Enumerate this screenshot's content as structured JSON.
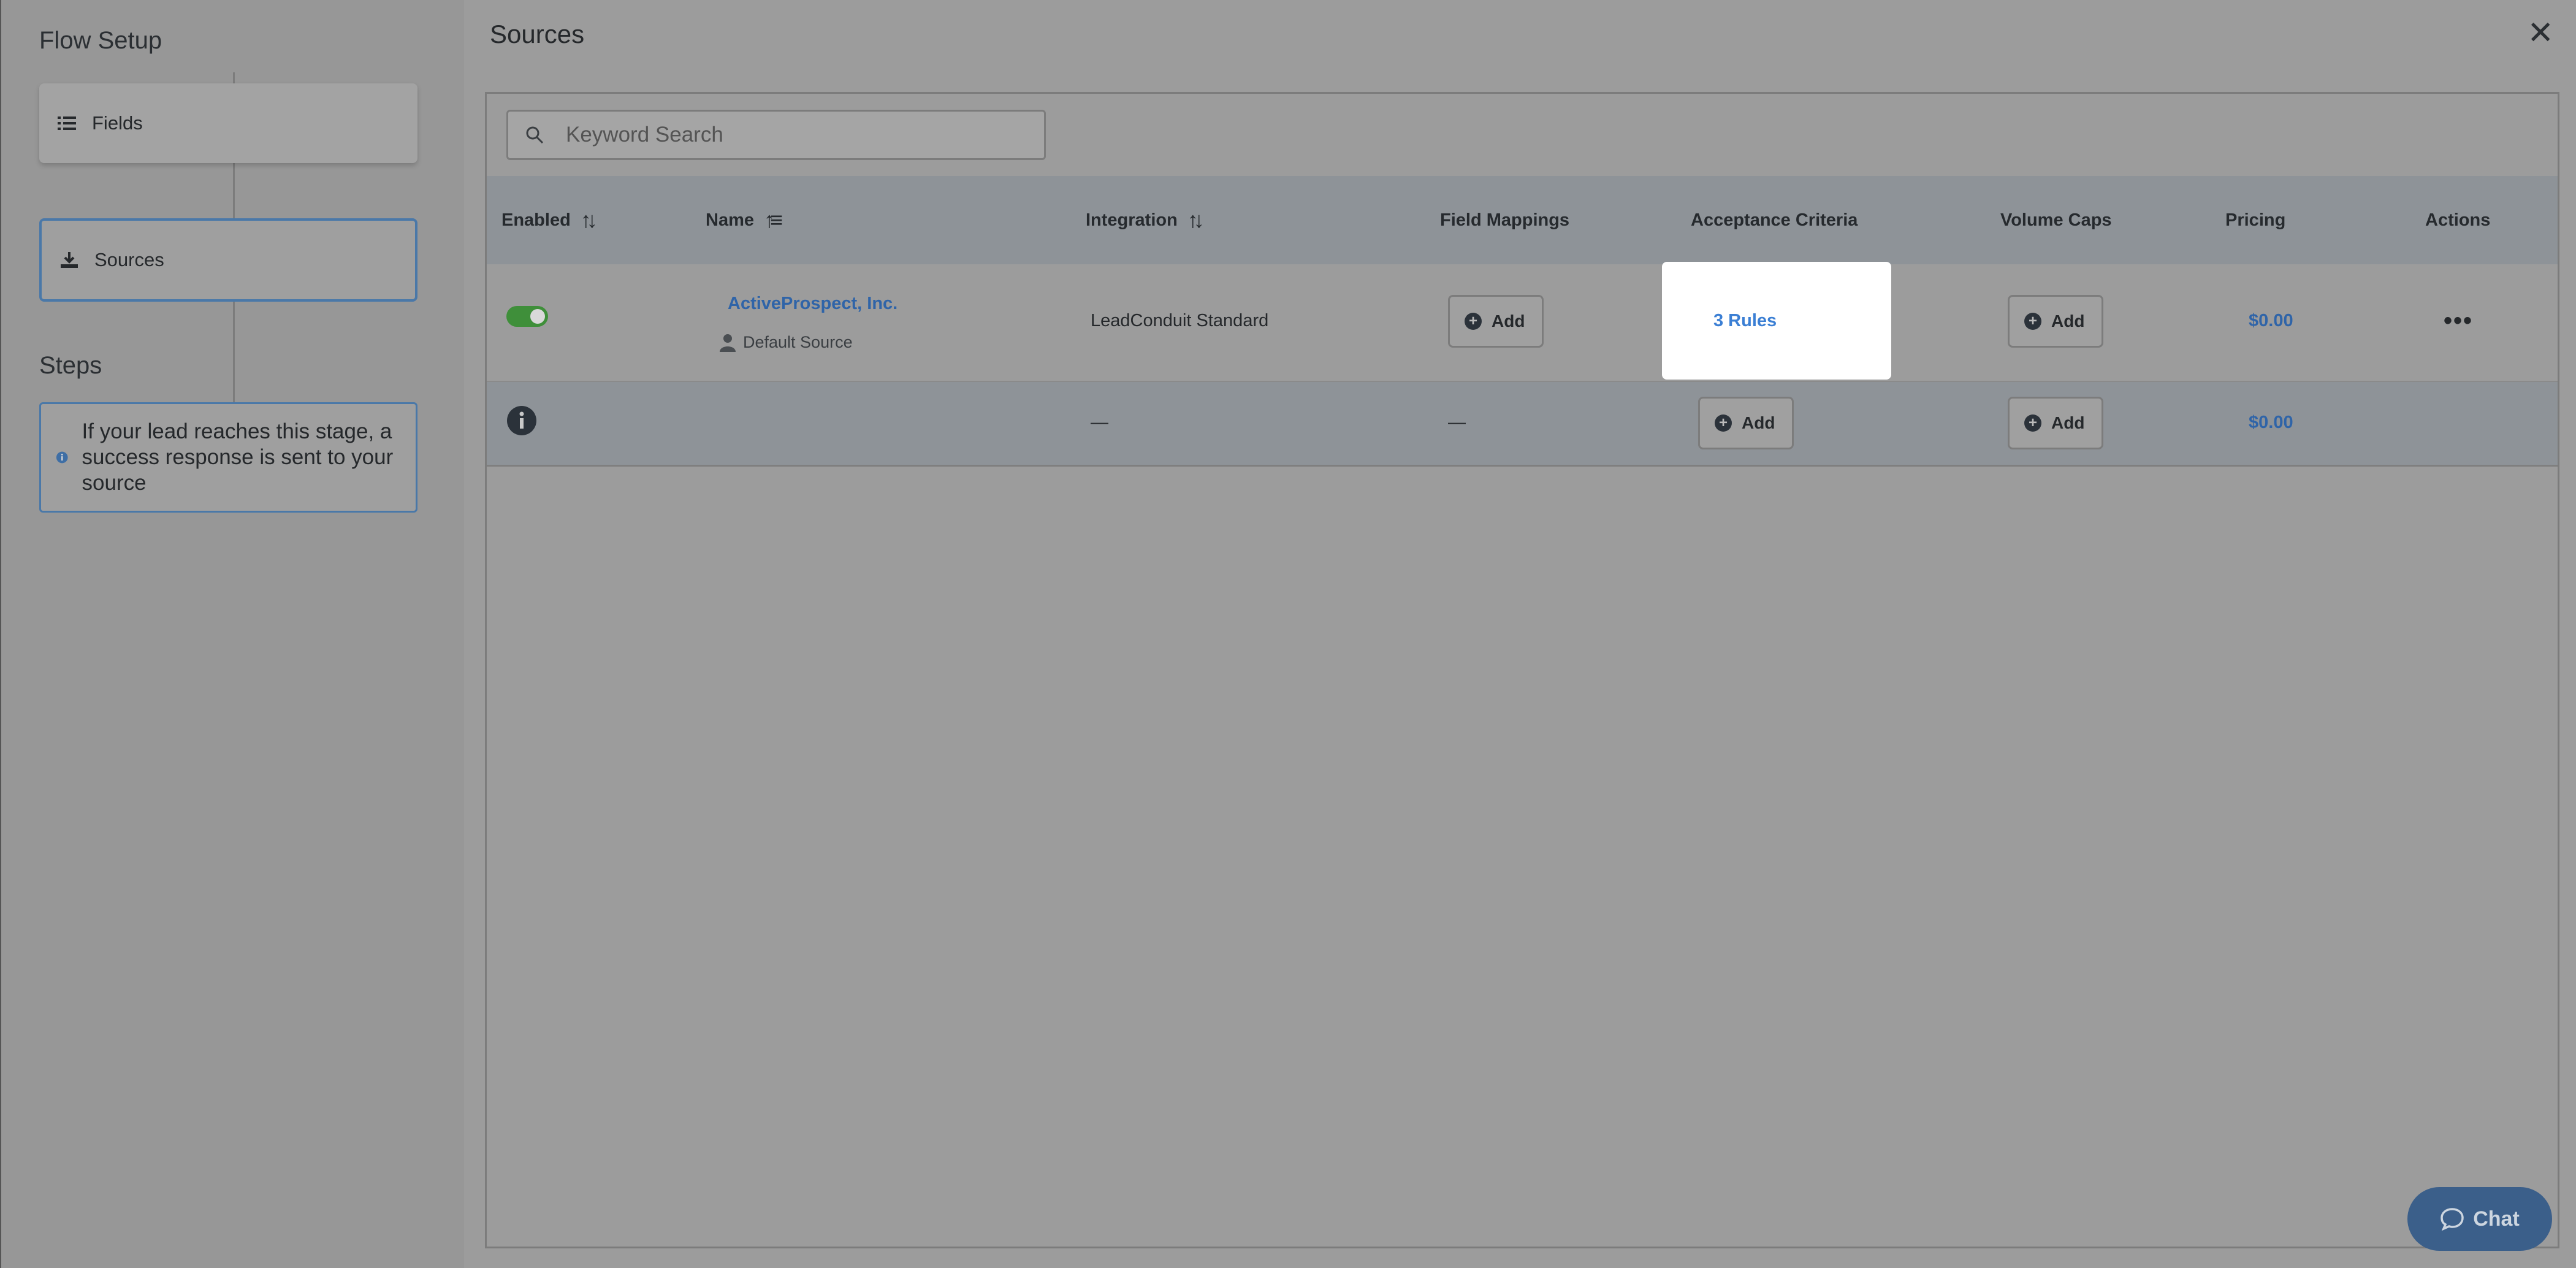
{
  "sidebar": {
    "title": "Flow Setup",
    "items": [
      {
        "label": "Fields",
        "icon": "list-icon"
      },
      {
        "label": "Sources",
        "icon": "download-icon"
      }
    ],
    "steps_title": "Steps",
    "info": {
      "text": "If your lead reaches this stage, a success response is sent to your source",
      "icon": "info-icon"
    }
  },
  "main": {
    "title": "Sources",
    "close_label": "✕",
    "search": {
      "placeholder": "Keyword Search"
    },
    "columns": [
      "Enabled",
      "Name",
      "Integration",
      "Field Mappings",
      "Acceptance Criteria",
      "Volume Caps",
      "Pricing",
      "Actions"
    ],
    "rows": [
      {
        "enabled": true,
        "name": "ActiveProspect, Inc.",
        "subtitle": "Default Source",
        "integration": "LeadConduit Standard",
        "field_mappings": "Add",
        "acceptance_criteria": "3 Rules",
        "volume_caps": "Add",
        "pricing": "$0.00",
        "actions": "•••"
      },
      {
        "integration": "—",
        "field_mappings": "—",
        "acceptance_criteria": "Add",
        "volume_caps": "Add",
        "pricing": "$0.00"
      }
    ]
  },
  "chat": {
    "label": "Chat"
  },
  "colors": {
    "accent": "#2f64a8",
    "toggle_on": "#3f8f3a",
    "highlight": "#ffffff"
  }
}
